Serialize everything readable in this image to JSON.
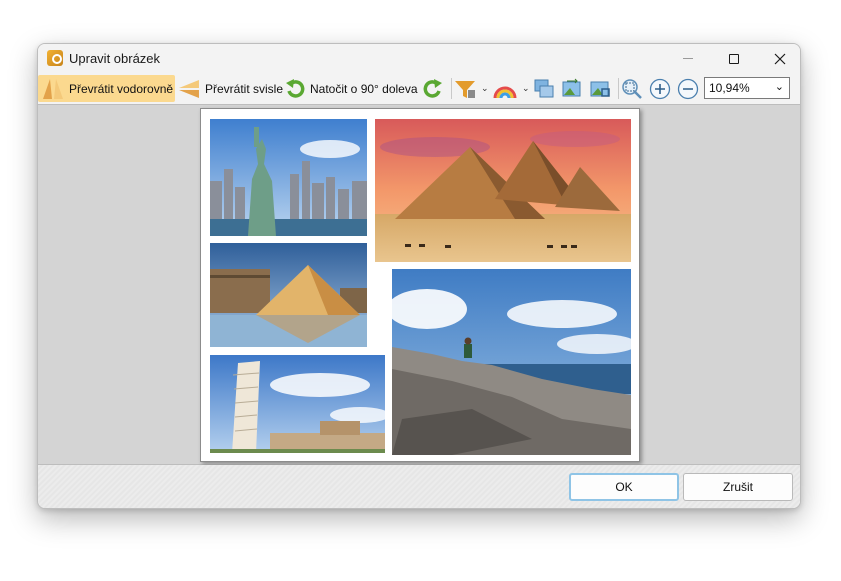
{
  "window": {
    "title": "Upravit obrázek"
  },
  "toolbar": {
    "flip_horizontal": "Převrátit vodorovně",
    "flip_vertical": "Převrátit svisle",
    "rotate_left": "Natočit o 90° doleva",
    "zoom_value": "10,94%"
  },
  "icons": [
    "app-logo-icon",
    "flip-horizontal-icon",
    "flip-vertical-icon",
    "rotate-left-icon",
    "rotate-right-icon",
    "filter-icon",
    "color-icon",
    "copy-image-icon",
    "replace-image-icon",
    "crop-image-icon",
    "zoom-fit-icon",
    "zoom-in-icon",
    "zoom-out-icon"
  ],
  "image": {
    "photos": [
      "statue-of-liberty-photo",
      "pyramids-photo",
      "louvre-photo",
      "seaside-rocks-photo",
      "leaning-tower-photo"
    ]
  },
  "footer": {
    "ok_label": "OK",
    "cancel_label": "Zrušit"
  },
  "colors": {
    "active_button": "#fbd98f",
    "ok_border": "#8fc4e6"
  }
}
